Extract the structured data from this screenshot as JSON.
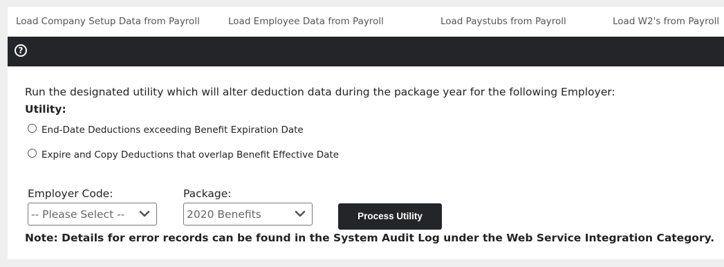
{
  "tabs": [
    {
      "label": "Load Company Setup Data from Payroll"
    },
    {
      "label": "Load Employee Data from Payroll"
    },
    {
      "label": "Load Paystubs from Payroll"
    },
    {
      "label": "Load W2's from Payroll"
    }
  ],
  "toolbar": {
    "help_icon": "?"
  },
  "main": {
    "description": "Run the designated utility which will alter deduction data during the package year for the following Employer:",
    "utility_label": "Utility:",
    "options": [
      {
        "label": "End-Date Deductions exceeding Benefit Expiration Date",
        "selected": false
      },
      {
        "label": "Expire and Copy Deductions that overlap Benefit Effective Date",
        "selected": false
      }
    ],
    "employer_code": {
      "label": "Employer Code:",
      "value": "-- Please Select --"
    },
    "package": {
      "label": "Package:",
      "value": "2020 Benefits"
    },
    "process_button": "Process Utility",
    "note": "Note: Details for error records can be found in the System Audit Log under the Web Service Integration Category."
  },
  "colors": {
    "dark_bar": "#232528",
    "background": "#efefef",
    "panel": "#ffffff"
  }
}
